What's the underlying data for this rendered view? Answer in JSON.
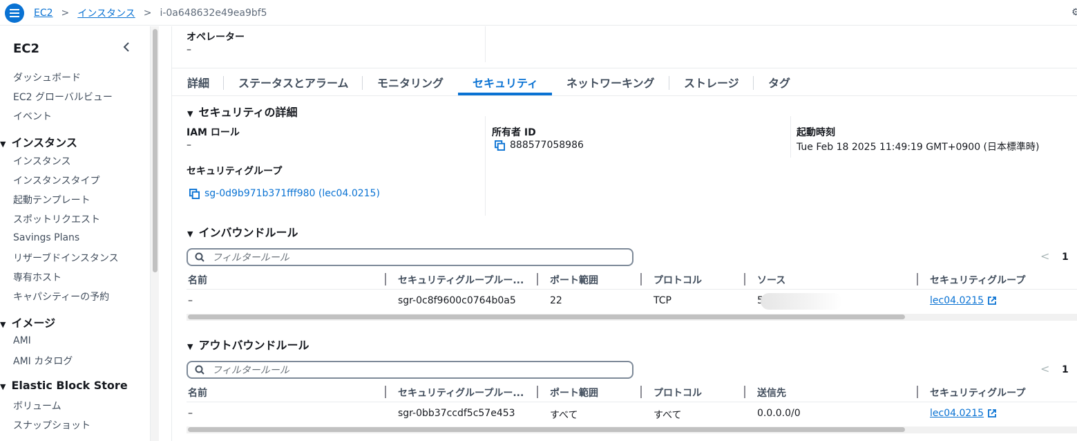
{
  "breadcrumb": {
    "items": [
      "EC2",
      "インスタンス"
    ],
    "separator": ">",
    "current": "i-0a648632e49ea9bf5"
  },
  "sidebar": {
    "title": "EC2",
    "items_top": [
      "ダッシュボード",
      "EC2 グローバルビュー",
      "イベント"
    ],
    "sections": [
      {
        "title": "インスタンス",
        "items": [
          "インスタンス",
          "インスタンスタイプ",
          "起動テンプレート",
          "スポットリクエスト",
          "Savings Plans",
          "リザーブドインスタンス",
          "専有ホスト",
          "キャパシティーの予約"
        ]
      },
      {
        "title": "イメージ",
        "items": [
          "AMI",
          "AMI カタログ"
        ]
      },
      {
        "title": "Elastic Block Store",
        "items": [
          "ボリューム",
          "スナップショット"
        ]
      }
    ]
  },
  "operator": {
    "label": "オペレーター",
    "value": "–"
  },
  "tabs": [
    "詳細",
    "ステータスとアラーム",
    "モニタリング",
    "セキュリティ",
    "ネットワーキング",
    "ストレージ",
    "タグ"
  ],
  "active_tab": "セキュリティ",
  "security_details": {
    "heading": "セキュリティの詳細",
    "iam_role_label": "IAM ロール",
    "iam_role_value": "–",
    "owner_id_label": "所有者 ID",
    "owner_id_value": "888577058986",
    "launch_time_label": "起動時刻",
    "launch_time_value": "Tue Feb 18 2025 11:49:19 GMT+0900 (日本標準時)",
    "security_groups_label": "セキュリティグループ",
    "security_group_link": "sg-0d9b971b371fff980 (lec04.0215)"
  },
  "inbound": {
    "heading": "インバウンドルール",
    "filter_placeholder": "フィルタールール",
    "page": "1",
    "columns": [
      "名前",
      "セキュリティグループルー...",
      "ポート範囲",
      "プロトコル",
      "ソース",
      "セキュリティグループ"
    ],
    "rows": [
      {
        "name": "–",
        "rule_id": "sgr-0c8f9600c0764b0a5",
        "port": "22",
        "protocol": "TCP",
        "source": "5",
        "sg": "lec04.0215"
      }
    ]
  },
  "outbound": {
    "heading": "アウトバウンドルール",
    "filter_placeholder": "フィルタールール",
    "page": "1",
    "columns": [
      "名前",
      "セキュリティグループルー...",
      "ポート範囲",
      "プロトコル",
      "送信先",
      "セキュリティグループ"
    ],
    "rows": [
      {
        "name": "–",
        "rule_id": "sgr-0bb37ccdf5c57e453",
        "port": "すべて",
        "protocol": "すべて",
        "destination": "0.0.0.0/0",
        "sg": "lec04.0215"
      }
    ]
  },
  "colors": {
    "accent": "#0972d3",
    "text": "#16191f",
    "muted": "#414d5c"
  }
}
